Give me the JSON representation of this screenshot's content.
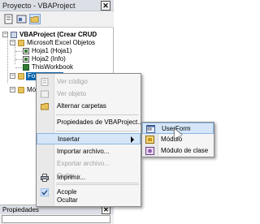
{
  "panel": {
    "title": "Proyecto - VBAProject",
    "close_glyph": "✕"
  },
  "tree": {
    "root": "VBAProject (Crear CRUD",
    "folder_objects": "Microsoft Excel Objetos",
    "sheet1": "Hoja1 (Hoja1)",
    "sheet2": "Hoja2 (Info)",
    "workbook": "ThisWorkbook",
    "folder_forms": "Formularios",
    "folder_modules": "Mó"
  },
  "context_menu": {
    "items": [
      {
        "label": "Ver código",
        "enabled": false
      },
      {
        "label": "Ver objeto",
        "enabled": false
      },
      {
        "label": "Alternar carpetas",
        "enabled": true
      },
      {
        "label": "Propiedades de VBAProject...",
        "enabled": true
      },
      {
        "label": "Insertar",
        "enabled": true,
        "submenu": true
      },
      {
        "label": "Importar archivo...",
        "enabled": true
      },
      {
        "label": "Exportar archivo...",
        "enabled": false
      },
      {
        "label": "Quitar",
        "enabled": false
      },
      {
        "label": "Imprimir...",
        "enabled": true
      },
      {
        "label": "Acople",
        "enabled": true,
        "checked": true
      },
      {
        "label": "Ocultar",
        "enabled": true
      }
    ]
  },
  "submenu": {
    "items": [
      {
        "label": "UserForm"
      },
      {
        "label": "Módulo"
      },
      {
        "label": "Módulo de clase"
      }
    ]
  },
  "properties": {
    "title": "Propiedades",
    "close_glyph": "✕"
  },
  "colors": {
    "selection": "#0a64ad",
    "hover": "#d5e6f8"
  }
}
